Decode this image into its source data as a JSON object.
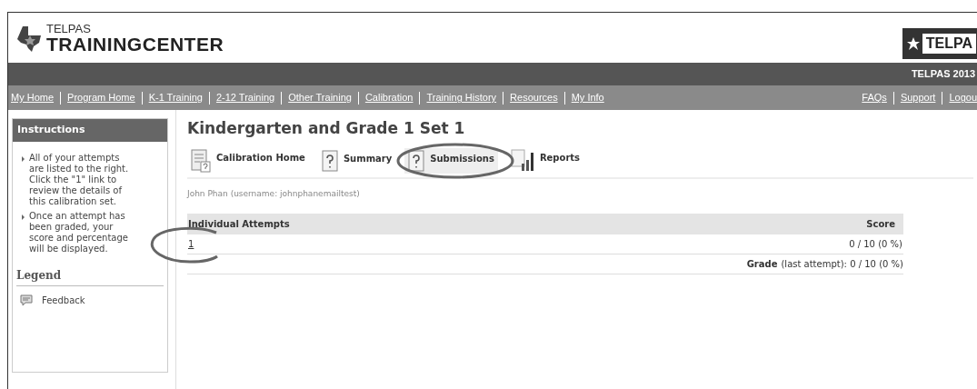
{
  "header": {
    "logo_top": "TELPAS",
    "logo_bottom": "TRAININGCENTER",
    "badge": "TELPA",
    "banner": "TELPAS 2013"
  },
  "nav": {
    "left": [
      {
        "label": "My Home"
      },
      {
        "label": "Program Home"
      },
      {
        "label": "K-1 Training"
      },
      {
        "label": "2-12 Training"
      },
      {
        "label": "Other Training"
      },
      {
        "label": "Calibration"
      },
      {
        "label": "Training History"
      },
      {
        "label": "Resources"
      },
      {
        "label": "My Info"
      }
    ],
    "right": [
      {
        "label": "FAQs"
      },
      {
        "label": "Support"
      },
      {
        "label": "Logou"
      }
    ]
  },
  "sidebar": {
    "title": "Instructions",
    "items": [
      "All of your attempts are listed to the right. Click the \"1\" link to review the details of this calibration set.",
      "Once an attempt has been graded, your score and percentage will be displayed."
    ],
    "legend_title": "Legend",
    "legend": [
      {
        "label": "Feedback"
      }
    ]
  },
  "page": {
    "title": "Kindergarten and Grade 1 Set 1",
    "tabs": [
      {
        "label": "Calibration Home",
        "kind": "home",
        "selected": false
      },
      {
        "label": "Summary",
        "kind": "question",
        "selected": false
      },
      {
        "label": "Submissions",
        "kind": "question",
        "selected": true
      },
      {
        "label": "Reports",
        "kind": "chart",
        "selected": false
      }
    ],
    "user": "John Phan (username: johnphanemailtest)",
    "table": {
      "columns": [
        "Individual Attempts",
        "Score"
      ],
      "rows": [
        {
          "attempt": "1",
          "score": "0 / 10 (0 %)"
        }
      ],
      "grade_label": "Grade",
      "grade_note": "(last attempt): 0 / 10 (0 %)"
    }
  }
}
